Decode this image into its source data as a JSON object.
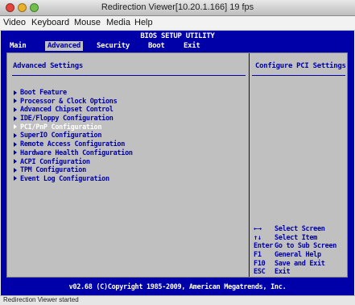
{
  "window": {
    "title": "Redirection Viewer[10.20.1.166]  19 fps"
  },
  "menubar": {
    "items": [
      "Video",
      "Keyboard",
      "Mouse",
      "Media",
      "Help"
    ]
  },
  "bios": {
    "title": "BIOS SETUP UTILITY",
    "tabs": [
      {
        "label": "Main",
        "active": false
      },
      {
        "label": "Advanced",
        "active": true
      },
      {
        "label": "Security",
        "active": false
      },
      {
        "label": "Boot",
        "active": false
      },
      {
        "label": "Exit",
        "active": false
      }
    ],
    "section_title": "Advanced Settings",
    "menu_items": [
      {
        "label": "Boot Feature",
        "selected": false
      },
      {
        "label": "Processor & Clock Options",
        "selected": false
      },
      {
        "label": "Advanced Chipset Control",
        "selected": false
      },
      {
        "label": "IDE/Floppy Configuration",
        "selected": false
      },
      {
        "label": "PCI/PnP Configuration",
        "selected": true
      },
      {
        "label": "SuperIO Configuration",
        "selected": false
      },
      {
        "label": "Remote Access Configuration",
        "selected": false
      },
      {
        "label": "Hardware Health Configuration",
        "selected": false
      },
      {
        "label": "ACPI Configuration",
        "selected": false
      },
      {
        "label": "TPM Configuration",
        "selected": false
      },
      {
        "label": "Event Log Configuration",
        "selected": false
      }
    ],
    "help_title": "Configure PCI Settings",
    "key_help": [
      {
        "key": "←→",
        "desc": "Select Screen"
      },
      {
        "key": "↑↓",
        "desc": "Select Item"
      },
      {
        "key": "Enter",
        "desc": "Go to Sub Screen"
      },
      {
        "key": "F1",
        "desc": "General Help"
      },
      {
        "key": "F10",
        "desc": "Save and Exit"
      },
      {
        "key": "ESC",
        "desc": "Exit"
      }
    ],
    "footer": "v02.68 (C)Copyright 1985-2009, American Megatrends, Inc."
  },
  "statusbar": {
    "text": "Redirection Viewer started"
  },
  "colors": {
    "bios_blue": "#0000a8",
    "bios_gray": "#c0c0c0",
    "selected_text": "#ffffff"
  }
}
